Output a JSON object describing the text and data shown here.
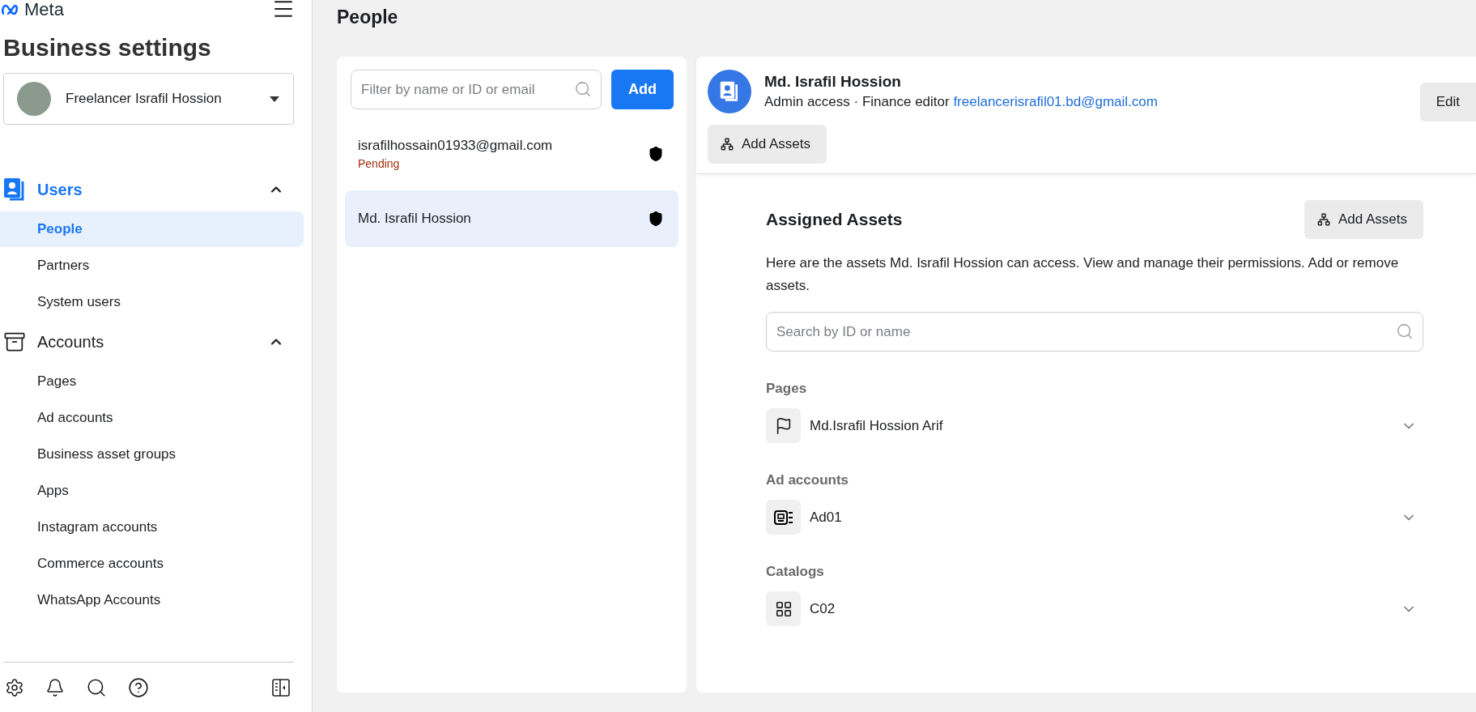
{
  "brand": "Meta",
  "sidebar": {
    "title": "Business settings",
    "account": {
      "name": "Freelancer Israfil Hossion"
    },
    "sections": [
      {
        "kind": "users",
        "label": "Users",
        "expanded": true,
        "selected": true,
        "items": [
          {
            "label": "People",
            "selected": true
          },
          {
            "label": "Partners",
            "selected": false
          },
          {
            "label": "System users",
            "selected": false
          }
        ]
      },
      {
        "kind": "accounts",
        "label": "Accounts",
        "expanded": true,
        "selected": false,
        "items": [
          {
            "label": "Pages",
            "selected": false
          },
          {
            "label": "Ad accounts",
            "selected": false
          },
          {
            "label": "Business asset groups",
            "selected": false
          },
          {
            "label": "Apps",
            "selected": false
          },
          {
            "label": "Instagram accounts",
            "selected": false
          },
          {
            "label": "Commerce accounts",
            "selected": false
          },
          {
            "label": "WhatsApp Accounts",
            "selected": false
          }
        ]
      }
    ]
  },
  "page_title": "People",
  "people_list": {
    "filter": {
      "placeholder": "Filter by name or ID or email"
    },
    "add_button": "Add",
    "rows": [
      {
        "name": "israfilhossain01933@gmail.com",
        "status": "Pending",
        "selected": false
      },
      {
        "name": "Md. Israfil Hossion",
        "selected": true
      }
    ]
  },
  "detail": {
    "name": "Md. Israfil Hossion",
    "roles": "Admin access · Finance editor",
    "email": "freelancerisrafil01.bd@gmail.com",
    "edit_button": "Edit",
    "add_assets_button": "Add Assets",
    "assigned": {
      "title": "Assigned Assets",
      "add_assets_button": "Add Assets",
      "description": "Here are the assets Md. Israfil Hossion can access. View and manage their permissions. Add or remove assets.",
      "search": {
        "placeholder": "Search by ID or name"
      },
      "groups": [
        {
          "label": "Pages",
          "kind": "page",
          "items": [
            {
              "name": "Md.Israfil Hossion Arif",
              "expanded": false
            }
          ]
        },
        {
          "label": "Ad accounts",
          "kind": "ad_account",
          "items": [
            {
              "name": "Ad01",
              "expanded": false
            }
          ]
        },
        {
          "label": "Catalogs",
          "kind": "catalog",
          "items": [
            {
              "name": "C02",
              "expanded": false
            }
          ]
        }
      ]
    }
  }
}
